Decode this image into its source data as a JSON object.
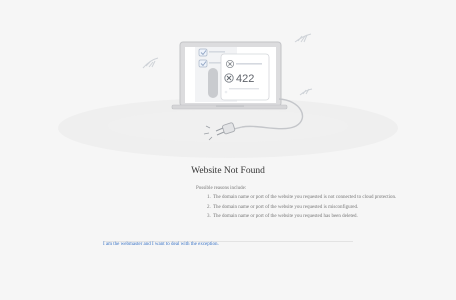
{
  "error": {
    "code": "422",
    "title": "Website Not Found"
  },
  "reasons": {
    "intro": "Possible reasons include:",
    "items": [
      "The domain name or port of the website you requested is not connected to cloud protection.",
      "The domain name or port of the website you requested is misconfigured.",
      "The domain name or port of the website you requested has been deleted."
    ]
  },
  "webmaster": {
    "link_label": "I am the webmaster and I want to deal with the exception."
  },
  "colors": {
    "background": "#f6f6f6",
    "link": "#3a74c7"
  },
  "icons": [
    "laptop-icon",
    "checkbox-icon",
    "x-mark-icon",
    "plug-icon",
    "cable-icon"
  ]
}
